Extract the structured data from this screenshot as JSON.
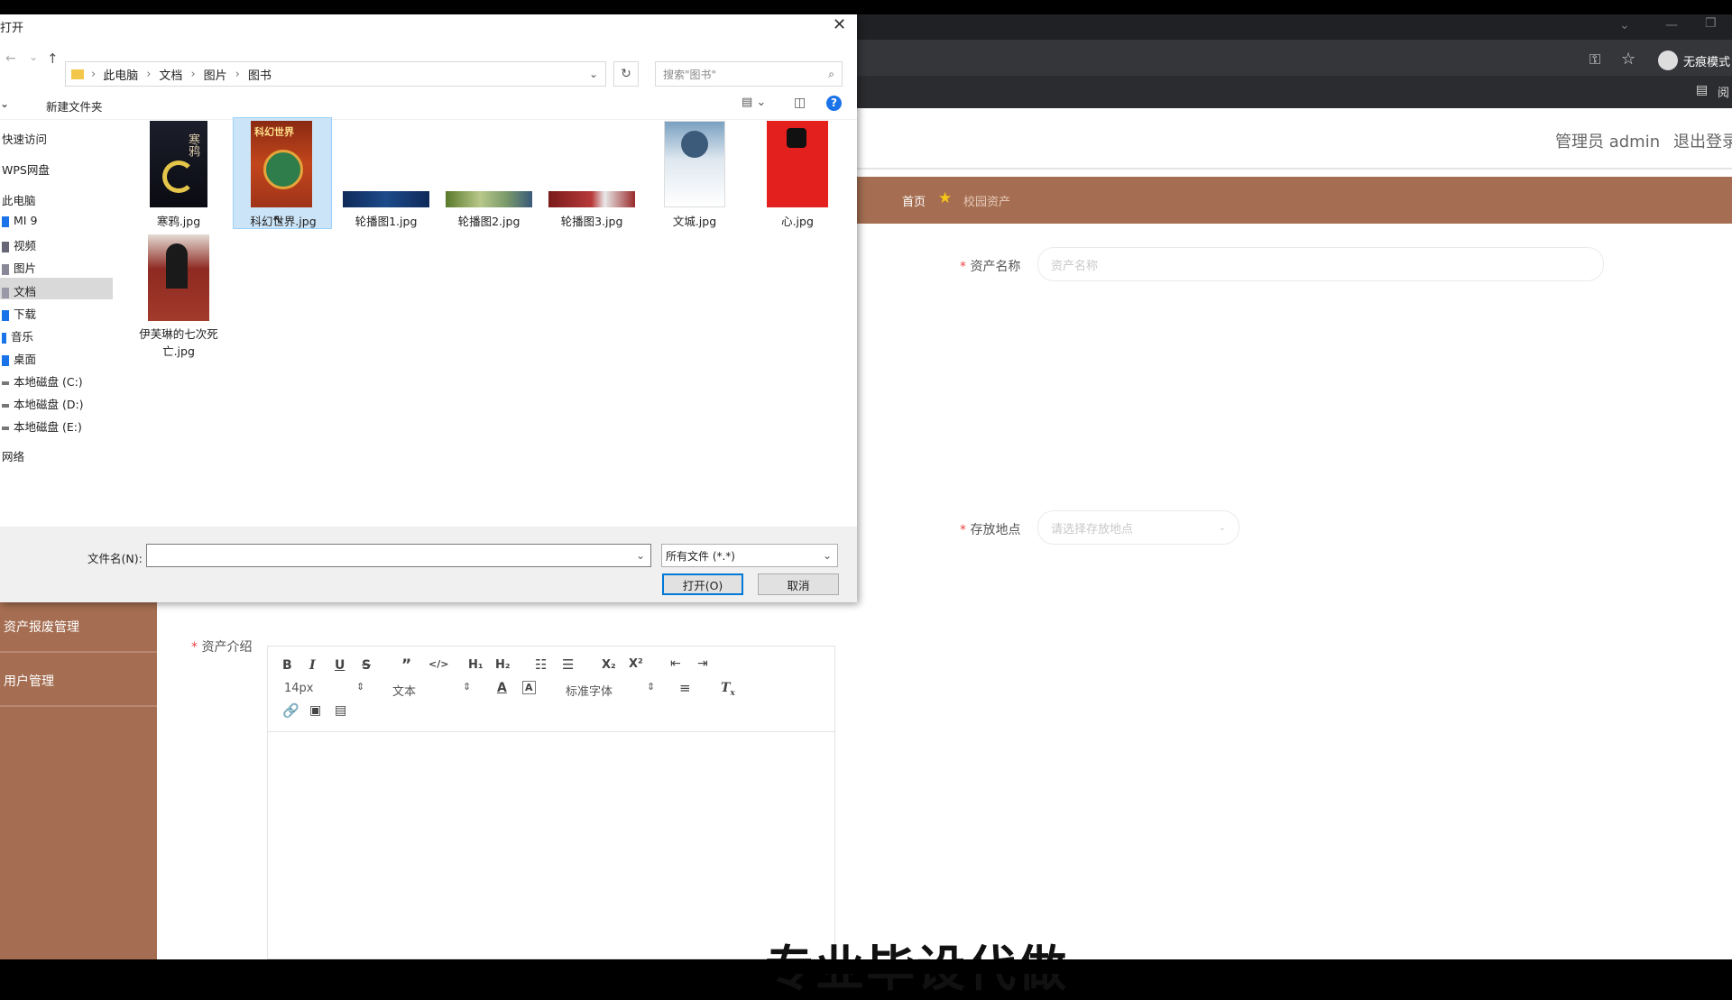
{
  "dialog": {
    "title": "打开",
    "breadcrumb": [
      "此电脑",
      "文档",
      "图片",
      "图书"
    ],
    "search_placeholder": "搜索\"图书\"",
    "new_folder": "新建文件夹",
    "nav": [
      {
        "label": "快速访问",
        "icon": "star-icon"
      },
      {
        "label": "WPS网盘",
        "icon": "cloud-icon"
      },
      {
        "label": "此电脑",
        "icon": "computer-icon"
      },
      {
        "label": "MI 9",
        "icon": "phone-icon"
      },
      {
        "label": "视频",
        "icon": "video-icon"
      },
      {
        "label": "图片",
        "icon": "picture-icon"
      },
      {
        "label": "文档",
        "icon": "document-icon"
      },
      {
        "label": "下载",
        "icon": "download-icon"
      },
      {
        "label": "音乐",
        "icon": "music-icon"
      },
      {
        "label": "桌面",
        "icon": "desktop-icon"
      },
      {
        "label": "本地磁盘 (C:)",
        "icon": "drive-icon"
      },
      {
        "label": "本地磁盘 (D:)",
        "icon": "drive-icon"
      },
      {
        "label": "本地磁盘 (E:)",
        "icon": "drive-icon"
      },
      {
        "label": "网络",
        "icon": "network-icon"
      }
    ],
    "files": [
      "寒鸦.jpg",
      "科幻世界.jpg",
      "轮播图1.jpg",
      "轮播图2.jpg",
      "轮播图3.jpg",
      "文城.jpg",
      "心.jpg",
      "伊芙琳的七次死亡.jpg"
    ],
    "filename_label": "文件名(N):",
    "filename_value": "",
    "filetype": "所有文件 (*.*)",
    "open_button": "打开(O)",
    "cancel_button": "取消",
    "cover_text": {
      "hanya": "寒鸦",
      "kehuan": "科幻世界"
    }
  },
  "browser": {
    "profile_label": "无痕模式",
    "reading_label": "阅"
  },
  "page": {
    "admin_label": "管理员 admin",
    "logout_label": "退出登录",
    "breadcrumb_home": "首页",
    "breadcrumb_current": "校园资产",
    "form": {
      "asset_name_label": "资产名称",
      "asset_name_placeholder": "资产名称",
      "location_label": "存放地点",
      "location_placeholder": "请选择存放地点",
      "intro_label": "资产介绍"
    },
    "sidebar": [
      "资产报废管理",
      "用户管理"
    ],
    "editor": {
      "font_size": "14px",
      "paragraph": "文本",
      "font_family": "标准字体"
    },
    "caption": "专业毕设代做"
  },
  "colors": {
    "accent": "#a56e52",
    "primary_button_border": "#0078d7"
  }
}
